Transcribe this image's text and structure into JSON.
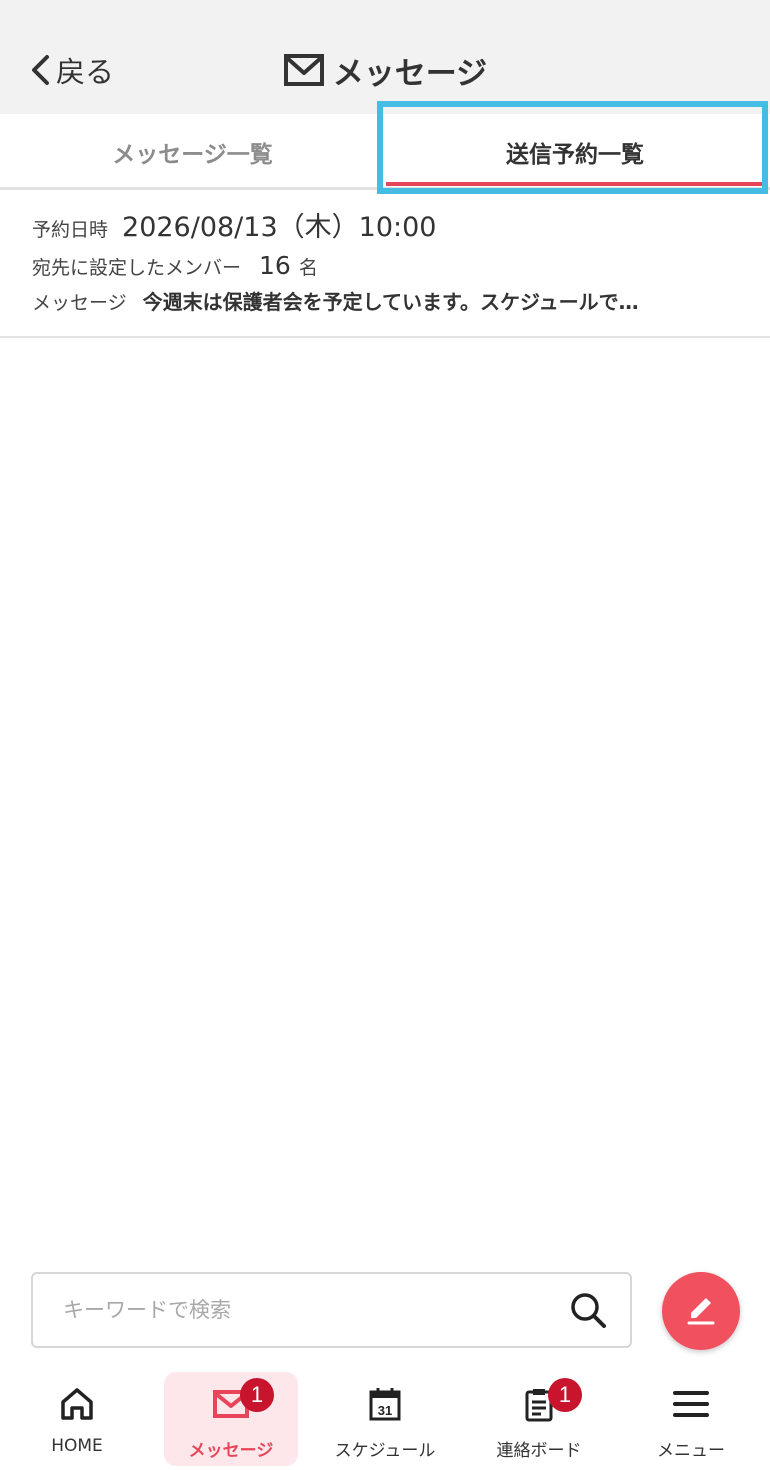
{
  "header": {
    "back_label": "戻る",
    "title": "メッセージ"
  },
  "tabs": [
    {
      "label": "メッセージ一覧",
      "active": false
    },
    {
      "label": "送信予約一覧",
      "active": true
    }
  ],
  "scheduled_item": {
    "date_label": "予約日時",
    "date_value": "2026/08/13（木）10:00",
    "recipients_label": "宛先に設定したメンバー",
    "recipients_count": "16",
    "recipients_unit": "名",
    "message_label": "メッセージ",
    "message_preview": "今週末は保護者会を予定しています。スケジュールで…"
  },
  "search": {
    "placeholder": "キーワードで検索"
  },
  "bottom_nav": [
    {
      "label": "HOME",
      "icon": "home-icon"
    },
    {
      "label": "メッセージ",
      "icon": "mail-icon",
      "badge": "1",
      "active": true
    },
    {
      "label": "スケジュール",
      "icon": "calendar-icon",
      "calendar_day": "31"
    },
    {
      "label": "連絡ボード",
      "icon": "clipboard-icon",
      "badge": "1"
    },
    {
      "label": "メニュー",
      "icon": "hamburger-icon"
    }
  ],
  "colors": {
    "accent": "#e8455a",
    "badge": "#c8142c",
    "highlight_border": "#45bde3",
    "fab": "#f1505f"
  }
}
